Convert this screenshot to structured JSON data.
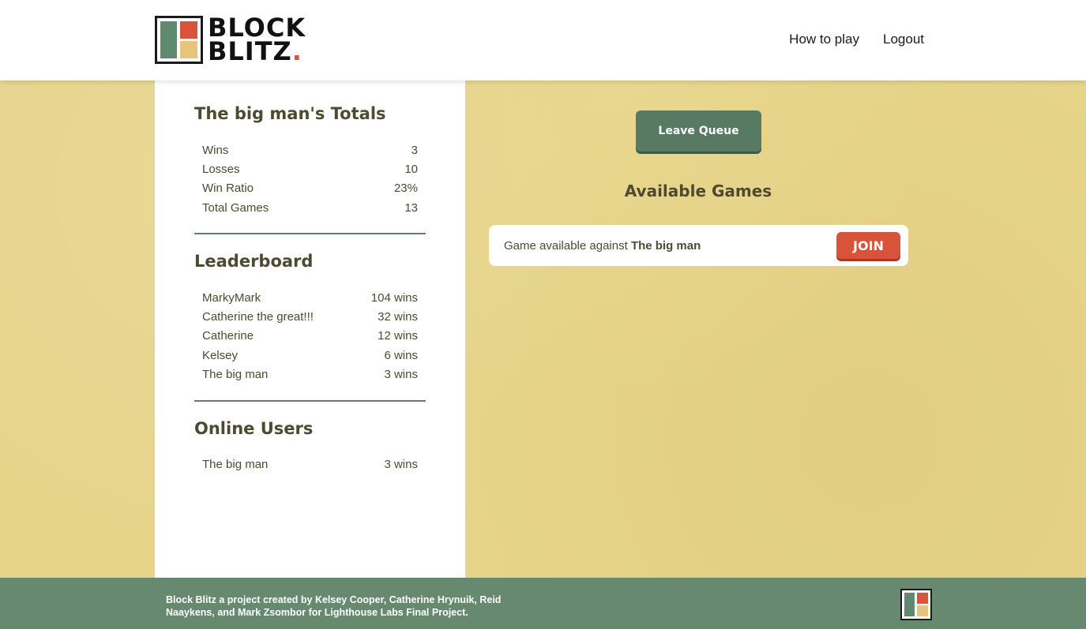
{
  "header": {
    "logo_line1": "BLOCK",
    "logo_line2": "BLITZ",
    "logo_dot": ".",
    "nav": {
      "how_to_play": "How to play",
      "logout": "Logout"
    }
  },
  "sidebar": {
    "totals": {
      "title": "The big man's Totals",
      "rows": [
        {
          "label": "Wins",
          "value": "3"
        },
        {
          "label": "Losses",
          "value": "10"
        },
        {
          "label": "Win Ratio",
          "value": "23%"
        },
        {
          "label": "Total Games",
          "value": "13"
        }
      ]
    },
    "leaderboard": {
      "title": "Leaderboard",
      "rows": [
        {
          "label": "MarkyMark",
          "value": "104 wins"
        },
        {
          "label": "Catherine the great!!!",
          "value": "32 wins"
        },
        {
          "label": "Catherine",
          "value": "12 wins"
        },
        {
          "label": "Kelsey",
          "value": "6 wins"
        },
        {
          "label": "The big man",
          "value": "3 wins"
        }
      ]
    },
    "online": {
      "title": "Online Users",
      "rows": [
        {
          "label": "The big man",
          "value": "3 wins"
        }
      ]
    }
  },
  "main": {
    "leave_queue_label": "Leave Queue",
    "available_games_title": "Available Games",
    "games": [
      {
        "prefix": "Game available against",
        "opponent": "The big man",
        "join_label": "JOIN"
      }
    ]
  },
  "footer": {
    "credits_line1": "Block Blitz a project created by Kelsey Cooper, Catherine Hrynuik, Reid",
    "credits_line2": "Naaykens, and Mark Zsombor for Lighthouse Labs Final Project."
  },
  "colors": {
    "accent_green": "#587a63",
    "accent_red": "#d9533b",
    "accent_yellow": "#e7c47c",
    "background": "#e6d48a",
    "footer": "#66896f"
  }
}
